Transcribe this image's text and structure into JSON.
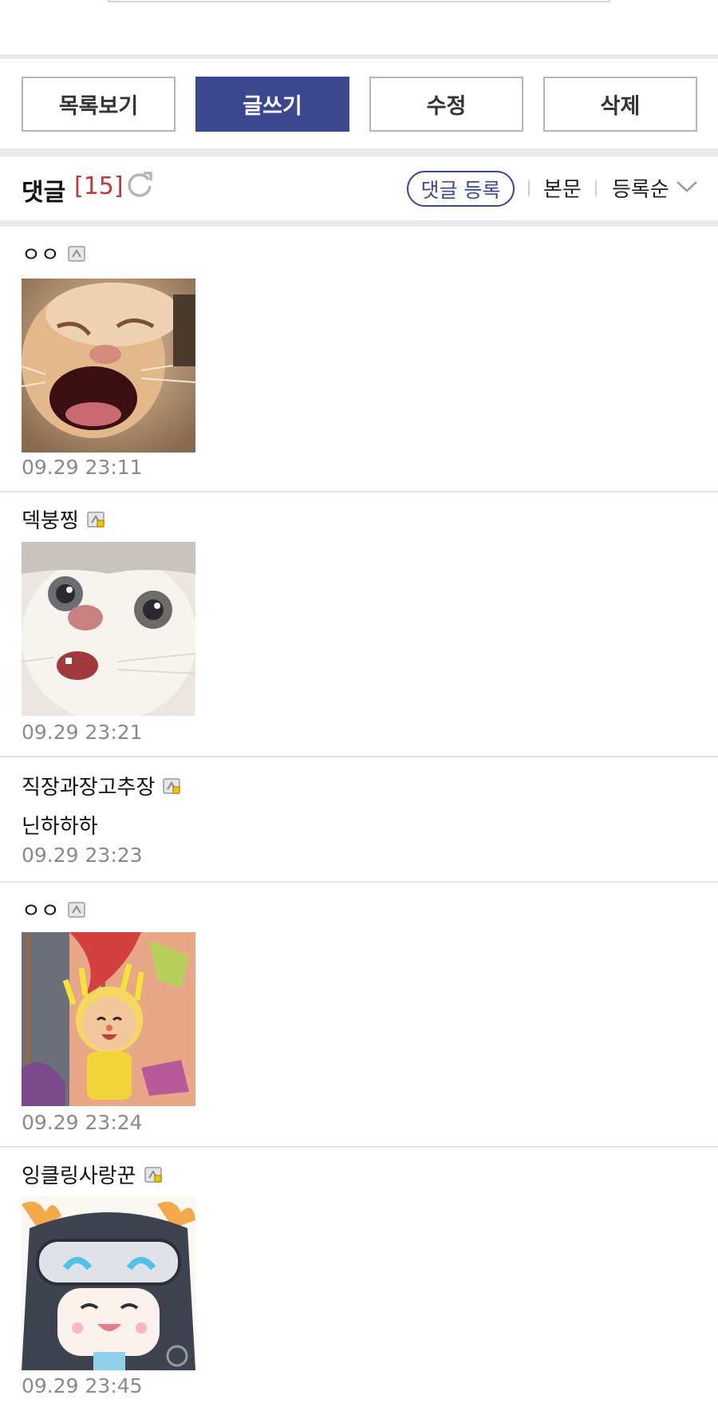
{
  "buttons": {
    "list": "목록보기",
    "write": "글쓰기",
    "edit": "수정",
    "delete": "삭제"
  },
  "comments_header": {
    "title": "댓글",
    "count": "[15]",
    "register": "댓글 등록",
    "body_link": "본문",
    "sort": "등록순"
  },
  "comments": [
    {
      "nick": "ㅇㅇ",
      "date": "09.29 23:11",
      "image": "laughing-cat-image"
    },
    {
      "nick": "덱붕찡",
      "date": "09.29 23:21",
      "image": "surprised-white-cat-image"
    },
    {
      "nick": "직장과장고추장",
      "text": "닌하하하",
      "date": "09.29 23:23"
    },
    {
      "nick": "ㅇㅇ",
      "date": "09.29 23:24",
      "image": "smiling-villager-image"
    },
    {
      "nick": "잉클링사랑꾼",
      "date": "09.29 23:45",
      "image": "anime-girl-goggles-image"
    }
  ],
  "colors": {
    "accent": "#3b4890",
    "count": "#c0383b",
    "date": "#8a8a8a"
  }
}
